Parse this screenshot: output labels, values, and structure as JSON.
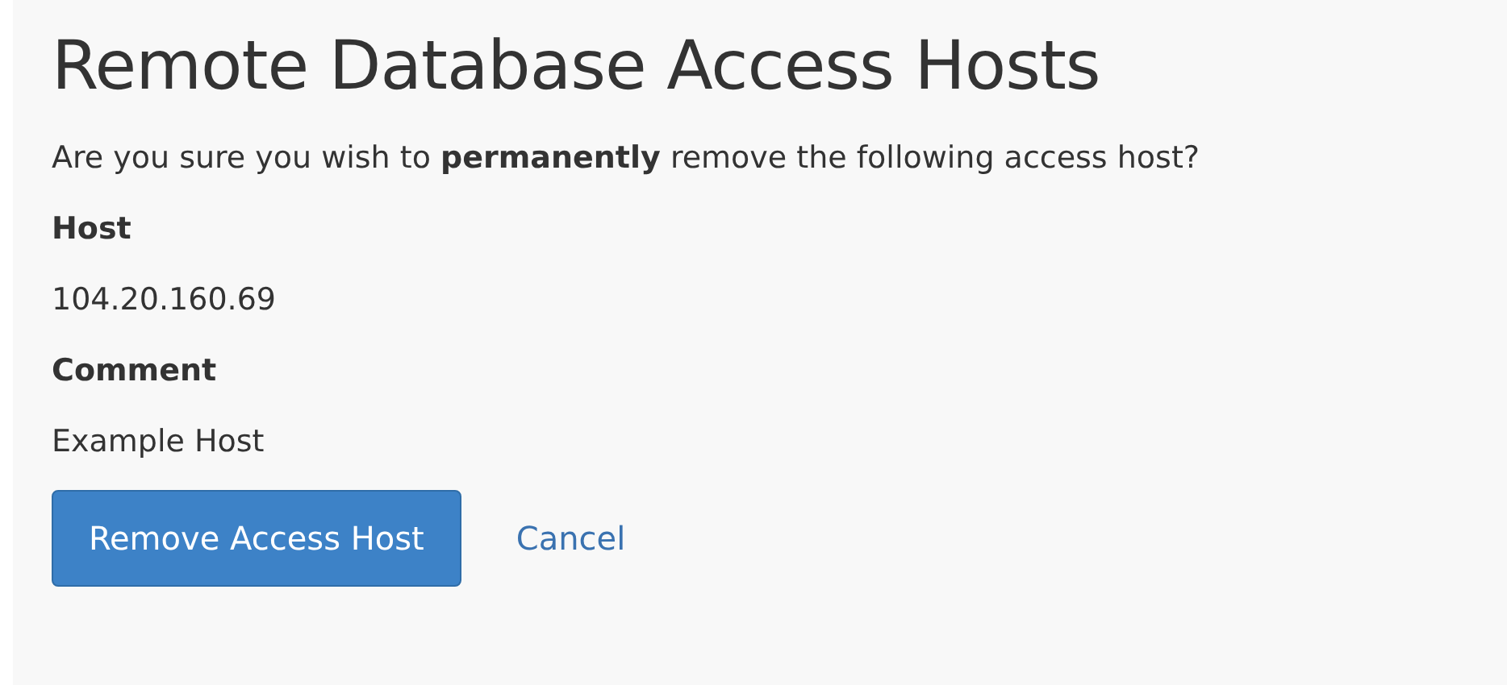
{
  "title": "Remote Database Access Hosts",
  "question": "Are you sure you wish to **permanently** remove the following access host?",
  "fields": [
    {
      "label": "Host",
      "value": "104.20.160.69"
    },
    {
      "label": "Comment",
      "value": "Example Host"
    }
  ],
  "buttons": [
    {
      "label": "Remove Access Host",
      "kind": "primary"
    },
    {
      "label": "Cancel",
      "kind": "link"
    }
  ]
}
